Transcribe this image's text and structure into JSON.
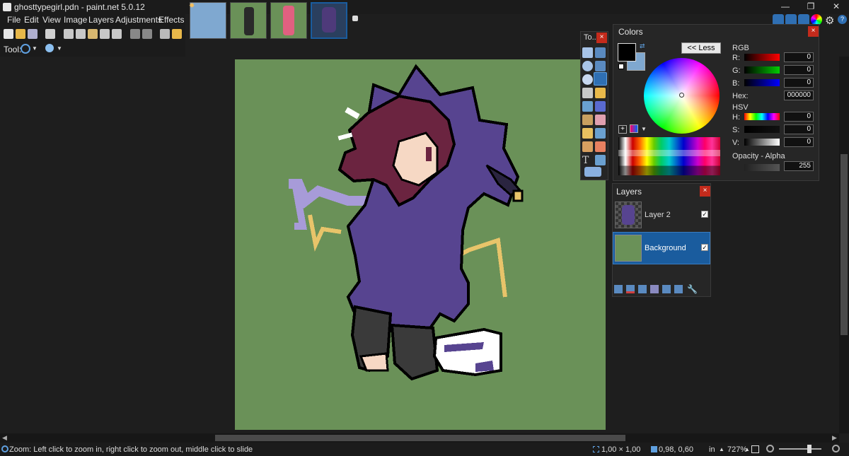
{
  "window": {
    "title": "ghosttypegirl.pdn - paint.net 5.0.12",
    "minimize": "—",
    "maximize": "❐",
    "close": "✕"
  },
  "menu": [
    "File",
    "Edit",
    "View",
    "Image",
    "Layers",
    "Adjustments",
    "Effects"
  ],
  "toolbar": {
    "tool_label": "Tool:"
  },
  "tools_window": {
    "title": "To...",
    "close": "×"
  },
  "colors_window": {
    "title": "Colors",
    "close": "×",
    "less_button": "<< Less",
    "rgb_label": "RGB",
    "r_label": "R:",
    "g_label": "G:",
    "b_label": "B:",
    "r_value": "0",
    "g_value": "0",
    "b_value": "0",
    "hex_label": "Hex:",
    "hex_value": "000000",
    "hsv_label": "HSV",
    "h_label": "H:",
    "s_label": "S:",
    "v_label": "V:",
    "h_value": "0",
    "s_value": "0",
    "v_value": "0",
    "opacity_label": "Opacity - Alpha",
    "alpha_value": "255",
    "primary_color": "#000000",
    "secondary_color": "#7fa8d0"
  },
  "layers_window": {
    "title": "Layers",
    "close": "×",
    "layers": [
      {
        "name": "Layer 2",
        "checked": "✓"
      },
      {
        "name": "Background",
        "checked": "✓"
      }
    ]
  },
  "status": {
    "hint": "Zoom: Left click to zoom in, right click to zoom out, middle click to slide",
    "selection_size": "1,00 × 1,00",
    "cursor_pos": "0,98, 0,60",
    "units": "in",
    "zoom": "727%"
  },
  "colors": {
    "canvas_bg": "#6a9158",
    "accent": "#1a5c9e"
  }
}
